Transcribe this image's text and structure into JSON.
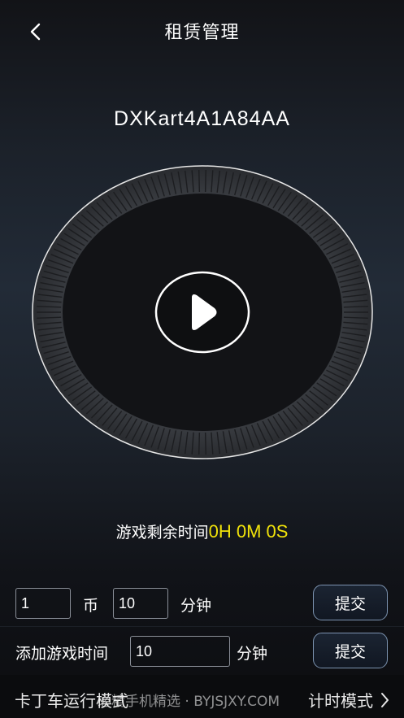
{
  "header": {
    "title": "租赁管理",
    "back_icon": "chevron-left-icon"
  },
  "device": {
    "id": "DXKart4A1A84AA"
  },
  "player": {
    "play_icon": "play-icon",
    "ring_color": "#ffffff"
  },
  "timer": {
    "label": "游戏剩余时间",
    "value": "0H 0M 0S",
    "value_color": "#f1e30a"
  },
  "coin_row": {
    "coins_value": "1",
    "coin_label": "币",
    "minutes_value": "10",
    "minutes_label": "分钟",
    "submit_label": "提交"
  },
  "add_row": {
    "label": "添加游戏时间",
    "minutes_value": "10",
    "minutes_label": "分钟",
    "submit_label": "提交"
  },
  "bottom": {
    "left_mode": "卡丁车运行模式",
    "right_mode": "计时模式",
    "watermark": "必精手机精选 · BYJSJXY.COM"
  }
}
